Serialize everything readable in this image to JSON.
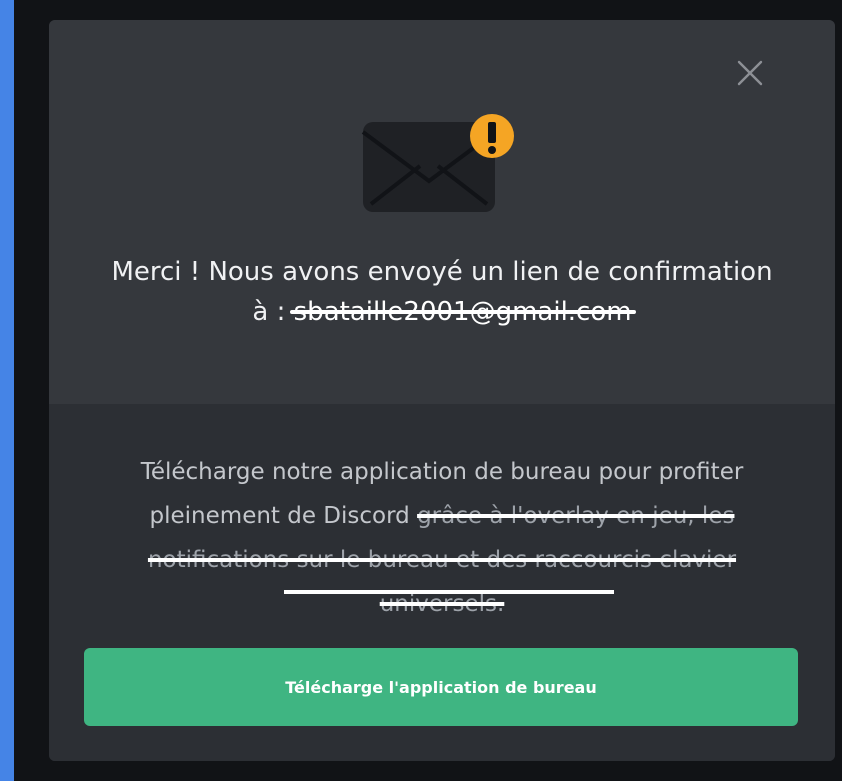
{
  "confirmation": {
    "line1": "Merci ! Nous avons envoyé un lien de confirmation",
    "line2_prefix": "à : ",
    "email": "sbataille2001@gmail.com"
  },
  "download": {
    "text_main": "Télécharge notre application de bureau pour profiter pleinement de Discord ",
    "text_struck": "grâce à l'overlay en jeu, les notifications sur le bureau et des raccourcis clavier universels.",
    "button_label": "Télécharge l'application de bureau"
  },
  "icons": {
    "close": "close-icon",
    "envelope": "envelope-icon",
    "warning": "warning-icon"
  },
  "colors": {
    "background": "#4584e6",
    "modal_top": "#35383d",
    "modal_bottom": "#2c2f34",
    "button": "#3fb582",
    "warning": "#f5a524"
  }
}
